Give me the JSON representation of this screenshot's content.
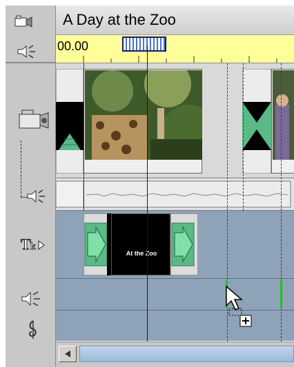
{
  "title": "A Day at the Zoo",
  "timecode": "00.00",
  "title_overlay_text": "At the Zoo",
  "icons": {
    "title_track": "movie-window-icon",
    "ruler": "speaker-icon",
    "video": "camcorder-icon",
    "audio": "speaker-icon",
    "text": "title-text-icon",
    "sfx": "speaker-icon",
    "music": "music-clef-icon"
  },
  "colors": {
    "ruler_bg": "#ffff99",
    "track_blue": "#8ea2b8",
    "transition_green": "#5bb987",
    "marker_green": "#18c818"
  }
}
